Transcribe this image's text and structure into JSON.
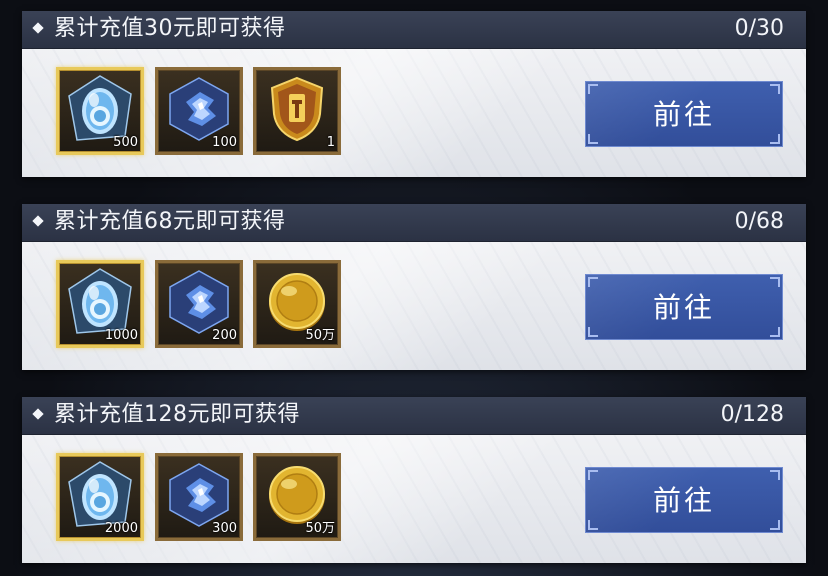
{
  "colors": {
    "header_bg": "#323a4e",
    "card_bg": "#eceef2",
    "button_bg": "#3a59a8",
    "frame_gold": "#e8c95a",
    "frame_bronze": "#8a6b3a"
  },
  "tiers": [
    {
      "title": "累计充值30元即可获得",
      "progress": "0/30",
      "button_label": "前往",
      "rewards": [
        {
          "icon": "crystal-egg-icon",
          "count": "500",
          "highlight": true
        },
        {
          "icon": "blue-crystal-shard-icon",
          "count": "100",
          "highlight": false
        },
        {
          "icon": "gold-shield-icon",
          "count": "1",
          "highlight": false
        }
      ]
    },
    {
      "title": "累计充值68元即可获得",
      "progress": "0/68",
      "button_label": "前往",
      "rewards": [
        {
          "icon": "crystal-egg-icon",
          "count": "1000",
          "highlight": true
        },
        {
          "icon": "blue-crystal-shard-icon",
          "count": "200",
          "highlight": false
        },
        {
          "icon": "gold-coin-icon",
          "count": "50万",
          "highlight": false
        }
      ]
    },
    {
      "title": "累计充值128元即可获得",
      "progress": "0/128",
      "button_label": "前往",
      "rewards": [
        {
          "icon": "crystal-egg-icon",
          "count": "2000",
          "highlight": true
        },
        {
          "icon": "blue-crystal-shard-icon",
          "count": "300",
          "highlight": false
        },
        {
          "icon": "gold-coin-icon",
          "count": "50万",
          "highlight": false
        }
      ]
    }
  ]
}
